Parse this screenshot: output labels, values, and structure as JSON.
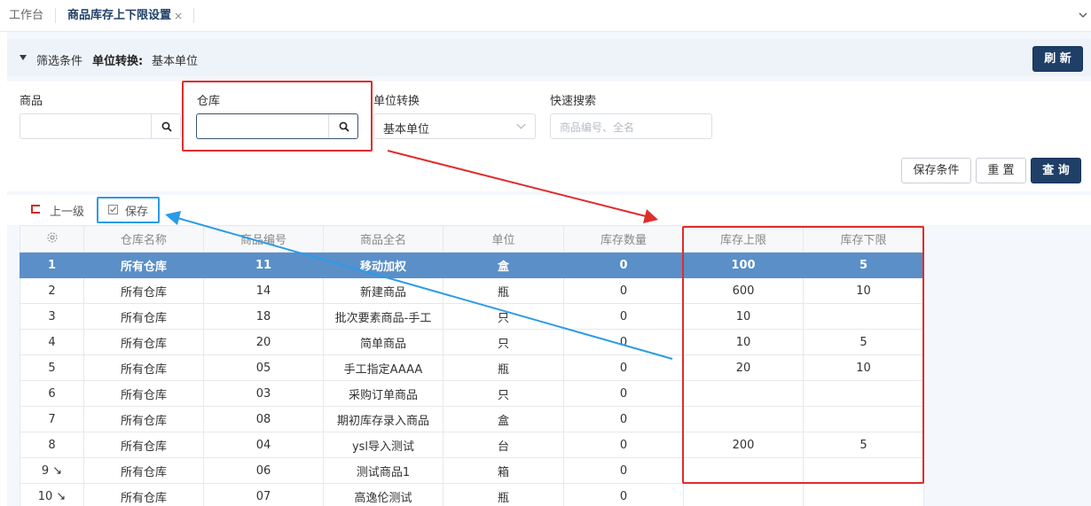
{
  "tabs": {
    "home": "工作台",
    "active": "商品库存上下限设置",
    "close": "×"
  },
  "filter": {
    "title": "筛选条件",
    "unit_label": "单位转换:",
    "unit_value": "基本单位"
  },
  "buttons": {
    "refresh": "刷 新",
    "save_condition": "保存条件",
    "reset": "重 置",
    "query": "查 询"
  },
  "form": {
    "product_label": "商品",
    "product_value": "",
    "warehouse_label": "仓库",
    "warehouse_value": "",
    "unit_label": "单位转换",
    "unit_value": "基本单位",
    "quick_label": "快速搜索",
    "quick_placeholder": "商品编号、全名"
  },
  "toolbar": {
    "up_level": "上一级",
    "save": "保存"
  },
  "grid": {
    "headers": [
      "仓库名称",
      "商品编号",
      "商品全名",
      "单位",
      "库存数量",
      "库存上限",
      "库存下限"
    ],
    "rows": [
      {
        "idx": "1",
        "warehouse": "所有仓库",
        "code": "11",
        "name": "移动加权",
        "unit": "盒",
        "qty": "0",
        "upper": "100",
        "lower": "5"
      },
      {
        "idx": "2",
        "warehouse": "所有仓库",
        "code": "14",
        "name": "新建商品",
        "unit": "瓶",
        "qty": "0",
        "upper": "600",
        "lower": "10"
      },
      {
        "idx": "3",
        "warehouse": "所有仓库",
        "code": "18",
        "name": "批次要素商品-手工",
        "unit": "只",
        "qty": "0",
        "upper": "10",
        "lower": ""
      },
      {
        "idx": "4",
        "warehouse": "所有仓库",
        "code": "20",
        "name": "简单商品",
        "unit": "只",
        "qty": "0",
        "upper": "10",
        "lower": "5"
      },
      {
        "idx": "5",
        "warehouse": "所有仓库",
        "code": "05",
        "name": "手工指定AAAA",
        "unit": "瓶",
        "qty": "0",
        "upper": "20",
        "lower": "10"
      },
      {
        "idx": "6",
        "warehouse": "所有仓库",
        "code": "03",
        "name": "采购订单商品",
        "unit": "只",
        "qty": "0",
        "upper": "",
        "lower": ""
      },
      {
        "idx": "7",
        "warehouse": "所有仓库",
        "code": "08",
        "name": "期初库存录入商品",
        "unit": "盒",
        "qty": "0",
        "upper": "",
        "lower": ""
      },
      {
        "idx": "8",
        "warehouse": "所有仓库",
        "code": "04",
        "name": "ysl导入测试",
        "unit": "台",
        "qty": "0",
        "upper": "200",
        "lower": "5"
      },
      {
        "idx": "9 ↘",
        "warehouse": "所有仓库",
        "code": "06",
        "name": "测试商品1",
        "unit": "箱",
        "qty": "0",
        "upper": "",
        "lower": ""
      },
      {
        "idx": "10 ↘",
        "warehouse": "所有仓库",
        "code": "07",
        "name": "高逸伦测试",
        "unit": "瓶",
        "qty": "0",
        "upper": "",
        "lower": ""
      }
    ]
  },
  "colors": {
    "accent": "#1f3f67",
    "selected_row": "#5a8fc8",
    "annotation_red": "#e02c2c",
    "annotation_blue": "#2a9be8"
  }
}
